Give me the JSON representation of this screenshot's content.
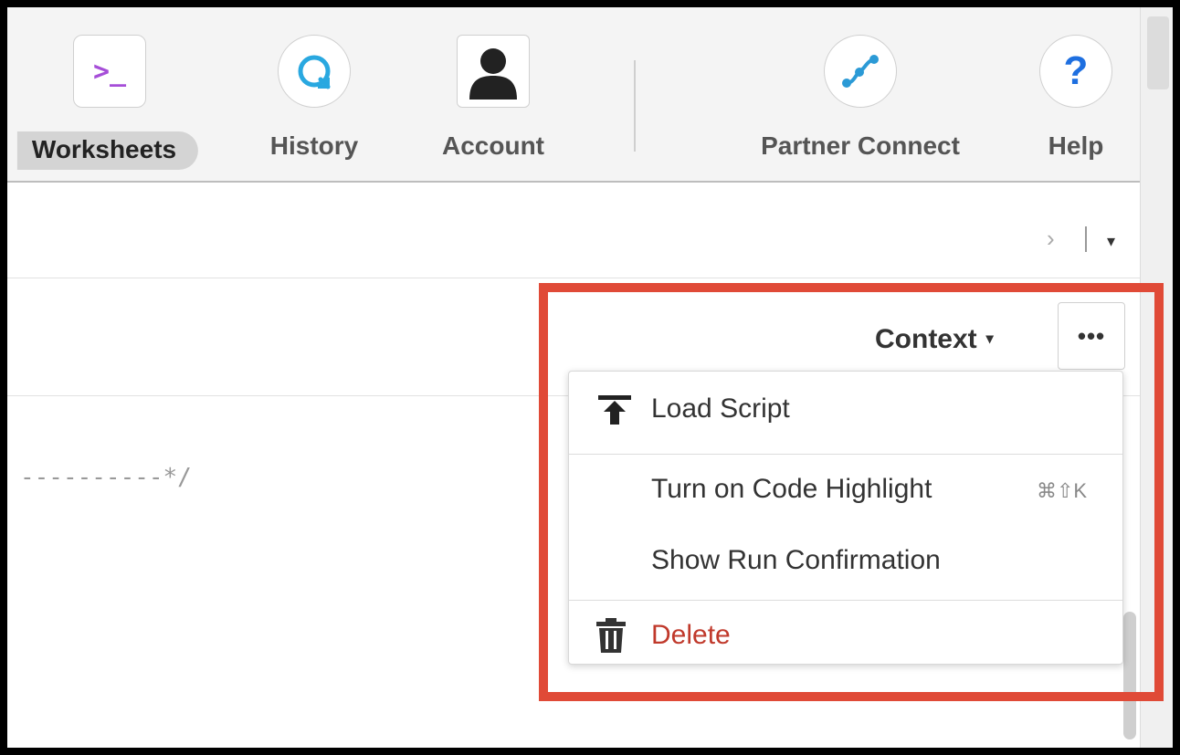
{
  "toolbar": {
    "worksheets": "Worksheets",
    "history": "History",
    "account": "Account",
    "partner_connect": "Partner Connect",
    "help": "Help",
    "worksheets_glyph": ">_",
    "help_glyph": "?"
  },
  "tabbar": {
    "chevron": "›",
    "caret": "▾"
  },
  "editor": {
    "context_label": "Context",
    "context_caret": "▾",
    "more_label": "•••",
    "code_text": "----------*/"
  },
  "menu": {
    "load_script": "Load Script",
    "code_highlight": "Turn on Code Highlight",
    "code_highlight_shortcut": "⌘⇧K",
    "run_confirmation": "Show Run Confirmation",
    "delete": "Delete"
  },
  "colors": {
    "highlight_border": "#e04a37",
    "delete_text": "#c0392b",
    "worksheets_icon": "#a64ed8",
    "history_icon": "#29a8e0",
    "partner_icon": "#2b9ad6",
    "help_icon": "#1e6fe0"
  },
  "icons": {
    "worksheets": "terminal-icon",
    "history": "history-icon",
    "account": "user-silhouette-icon",
    "partner_connect": "partner-connect-icon",
    "help": "help-icon",
    "load_script": "upload-icon",
    "delete": "trash-icon"
  }
}
